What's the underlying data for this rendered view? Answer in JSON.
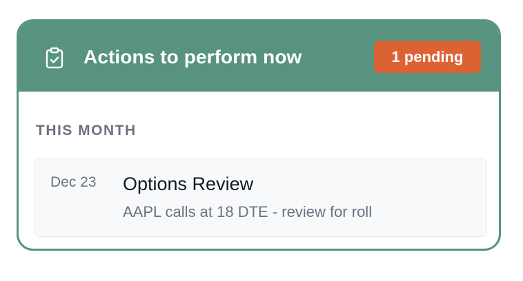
{
  "card": {
    "title": "Actions to perform now",
    "icon": "clipboard-check-icon",
    "badge": "1 pending"
  },
  "section": {
    "label": "THIS MONTH"
  },
  "items": [
    {
      "date": "Dec 23",
      "title": "Options Review",
      "description": "AAPL calls at 18 DTE - review for roll"
    }
  ],
  "colors": {
    "header": "#57937f",
    "badge": "#dd6233",
    "muted_text": "#6b7280",
    "item_background": "#f8f9fb"
  }
}
